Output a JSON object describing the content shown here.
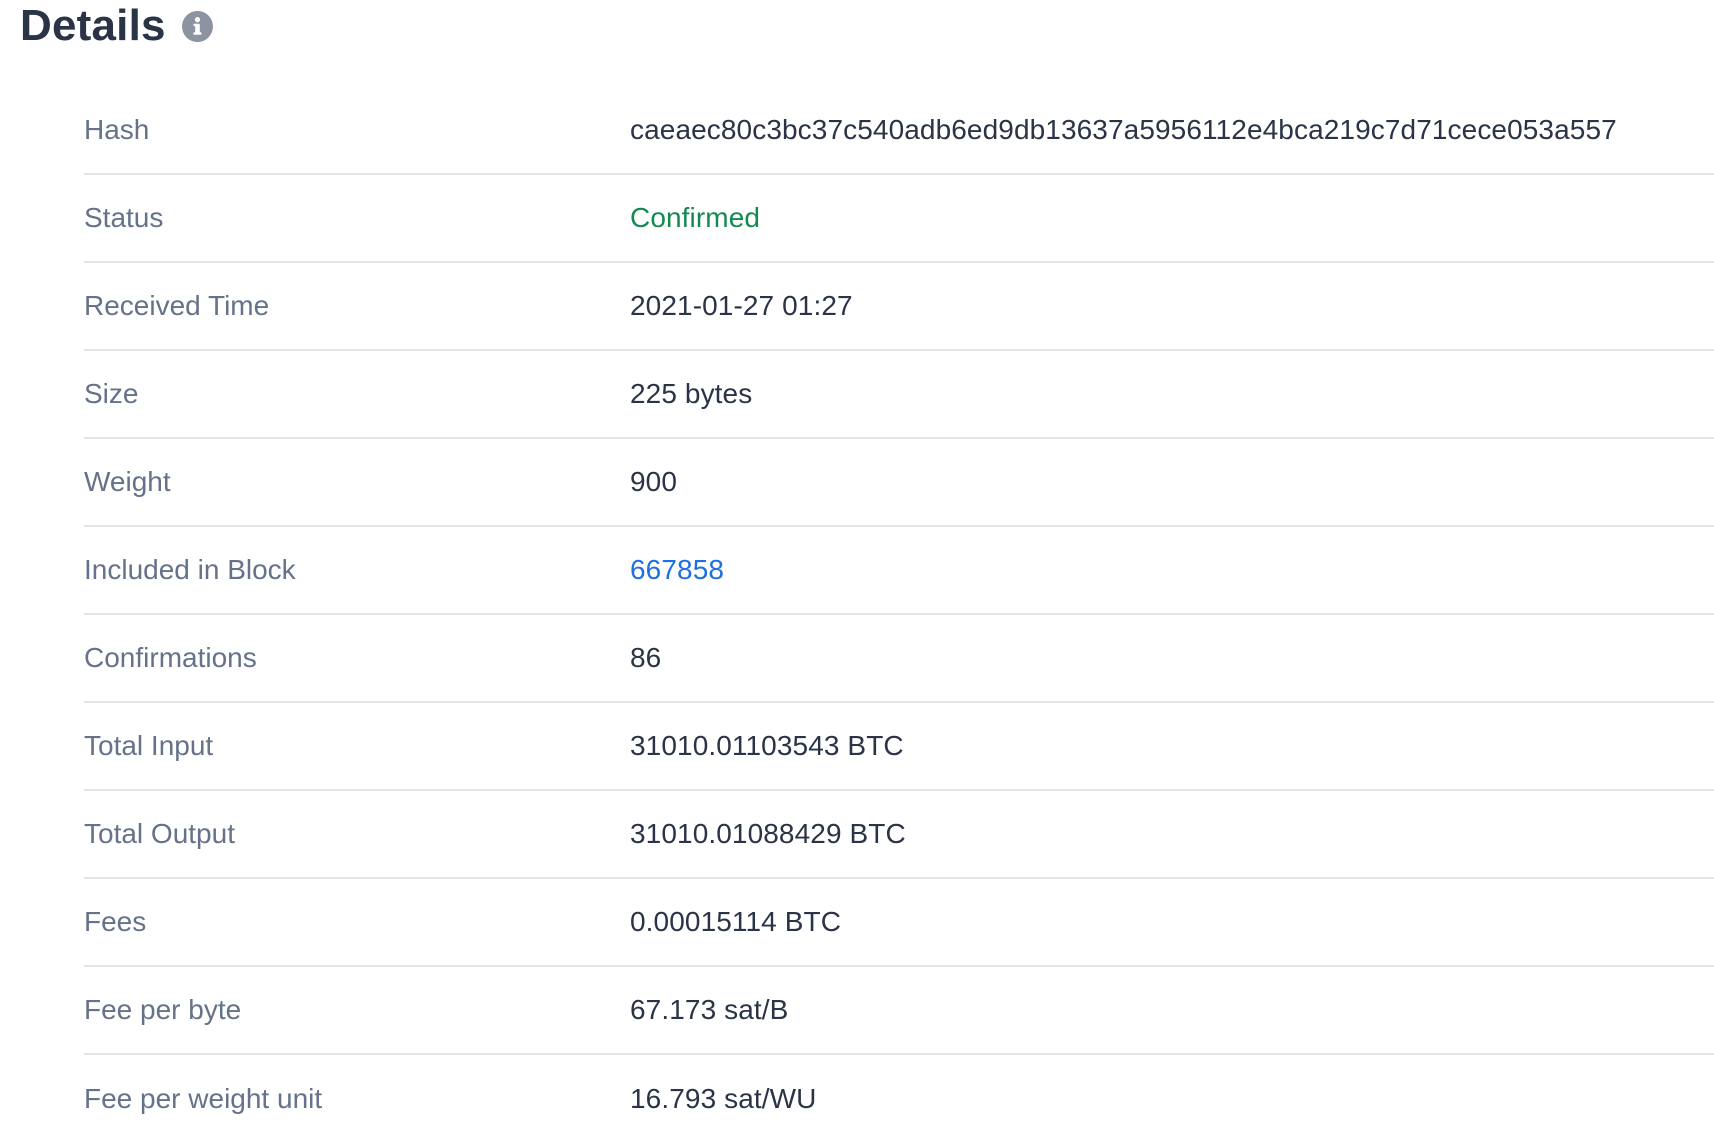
{
  "header": {
    "title": "Details",
    "info_icon": "info-circle-icon"
  },
  "colors": {
    "title": "#2a3446",
    "label": "#66718a",
    "value": "#2a3446",
    "status_confirmed": "#138a52",
    "link": "#1f6fe0",
    "divider": "#e2e5ea",
    "info_icon": "#8c93a1"
  },
  "details": [
    {
      "label": "Hash",
      "value": "caeaec80c3bc37c540adb6ed9db13637a5956112e4bca219c7d71cece053a557"
    },
    {
      "label": "Status",
      "value": "Confirmed"
    },
    {
      "label": "Received Time",
      "value": "2021-01-27 01:27"
    },
    {
      "label": "Size",
      "value": "225 bytes"
    },
    {
      "label": "Weight",
      "value": "900"
    },
    {
      "label": "Included in Block",
      "value": "667858"
    },
    {
      "label": "Confirmations",
      "value": "86"
    },
    {
      "label": "Total Input",
      "value": "31010.01103543 BTC"
    },
    {
      "label": "Total Output",
      "value": "31010.01088429 BTC"
    },
    {
      "label": "Fees",
      "value": "0.00015114 BTC"
    },
    {
      "label": "Fee per byte",
      "value": "67.173 sat/B"
    },
    {
      "label": "Fee per weight unit",
      "value": "16.793 sat/WU"
    }
  ]
}
